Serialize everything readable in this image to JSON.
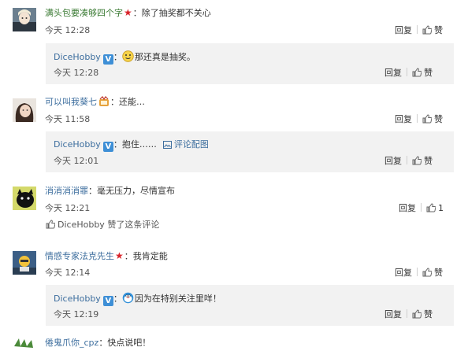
{
  "comments": [
    {
      "user": "满头包要凑够四个字",
      "text": "：除了抽奖都不关心",
      "time": "今天 12:28",
      "reply_label": "回复",
      "like_label": "赞",
      "reply": {
        "user": "DiceHobby",
        "text": "那还真是抽奖。",
        "time": "今天 12:28",
        "reply_label": "回复",
        "like_label": "赞"
      }
    },
    {
      "user": "可以叫我葵七",
      "text": "：还能…",
      "time": "今天 11:58",
      "reply_label": "回复",
      "like_label": "赞",
      "reply": {
        "user": "DiceHobby",
        "text": "：抱住……",
        "pic_link": "评论配图",
        "time": "今天 12:01",
        "reply_label": "回复",
        "like_label": "赞"
      }
    },
    {
      "user": "消消消消罪",
      "text": "：毫无压力，尽情宣布",
      "time": "今天 12:21",
      "reply_label": "回复",
      "like_count": "1",
      "liked_by": "DiceHobby 赞了这条评论"
    },
    {
      "user": "情感专家法克先生",
      "text": "：我肯定能",
      "time": "今天 12:14",
      "reply_label": "回复",
      "like_label": "赞",
      "reply": {
        "user": "DiceHobby",
        "text": "因为在特别关注里咩！",
        "time": "今天 12:19",
        "reply_label": "回复",
        "like_label": "赞"
      }
    },
    {
      "user": "倦鬼爪你_cpz",
      "text": "：快点说吧！"
    }
  ]
}
